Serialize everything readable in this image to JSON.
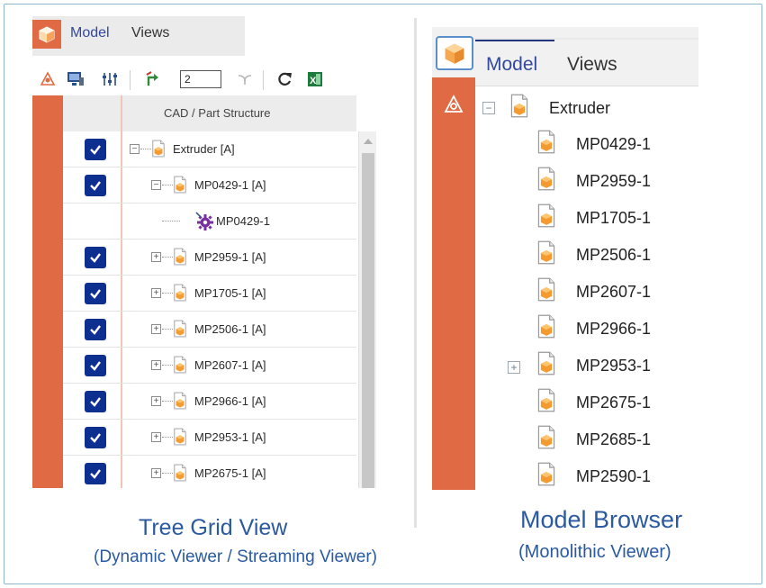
{
  "left_panel": {
    "tabs": [
      {
        "label": "Model",
        "active": true
      },
      {
        "label": "Views",
        "active": false
      }
    ],
    "toolbar": {
      "level_input_value": "2",
      "icons": [
        "structure-icon",
        "monitor-icon",
        "sliders-icon",
        "expand-level-icon",
        "collapse-icon",
        "refresh-icon",
        "excel-icon"
      ]
    },
    "grid": {
      "column_header": "CAD / Part Structure",
      "rows": [
        {
          "label": "Extruder [A]",
          "checked": true,
          "level": 0,
          "toggle": "−",
          "icon": "part-icon"
        },
        {
          "label": "MP0429-1 [A]",
          "checked": true,
          "level": 1,
          "toggle": "−",
          "icon": "part-icon"
        },
        {
          "label": "MP0429-1",
          "checked": false,
          "level": 2,
          "toggle": "",
          "icon": "gear-icon"
        },
        {
          "label": "MP2959-1 [A]",
          "checked": true,
          "level": 1,
          "toggle": "+",
          "icon": "part-icon"
        },
        {
          "label": "MP1705-1 [A]",
          "checked": true,
          "level": 1,
          "toggle": "+",
          "icon": "part-icon"
        },
        {
          "label": "MP2506-1 [A]",
          "checked": true,
          "level": 1,
          "toggle": "+",
          "icon": "part-icon"
        },
        {
          "label": "MP2607-1 [A]",
          "checked": true,
          "level": 1,
          "toggle": "+",
          "icon": "part-icon"
        },
        {
          "label": "MP2966-1 [A]",
          "checked": true,
          "level": 1,
          "toggle": "+",
          "icon": "part-icon"
        },
        {
          "label": "MP2953-1 [A]",
          "checked": true,
          "level": 1,
          "toggle": "+",
          "icon": "part-icon"
        },
        {
          "label": "MP2675-1 [A]",
          "checked": true,
          "level": 1,
          "toggle": "+",
          "icon": "part-icon"
        }
      ]
    },
    "caption": {
      "title": "Tree Grid View",
      "subtitle": "(Dynamic Viewer / Streaming Viewer)"
    }
  },
  "right_panel": {
    "tabs": [
      {
        "label": "Model",
        "active": true
      },
      {
        "label": "Views",
        "active": false
      }
    ],
    "tree": {
      "root": {
        "label": "Extruder",
        "toggle": "−"
      },
      "items": [
        {
          "label": "MP0429-1",
          "toggle": ""
        },
        {
          "label": "MP2959-1",
          "toggle": ""
        },
        {
          "label": "MP1705-1",
          "toggle": ""
        },
        {
          "label": "MP2506-1",
          "toggle": ""
        },
        {
          "label": "MP2607-1",
          "toggle": ""
        },
        {
          "label": "MP2966-1",
          "toggle": ""
        },
        {
          "label": "MP2953-1",
          "toggle": "+"
        },
        {
          "label": "MP2675-1",
          "toggle": ""
        },
        {
          "label": "MP2685-1",
          "toggle": ""
        },
        {
          "label": "MP2590-1",
          "toggle": ""
        }
      ]
    },
    "caption": {
      "title": "Model Browser",
      "subtitle": "(Monolithic Viewer)"
    }
  },
  "colors": {
    "accent": "#e06a44",
    "checkbox": "#0d2f8f",
    "caption": "#2a5aa0",
    "active_tab": "#33489d"
  }
}
